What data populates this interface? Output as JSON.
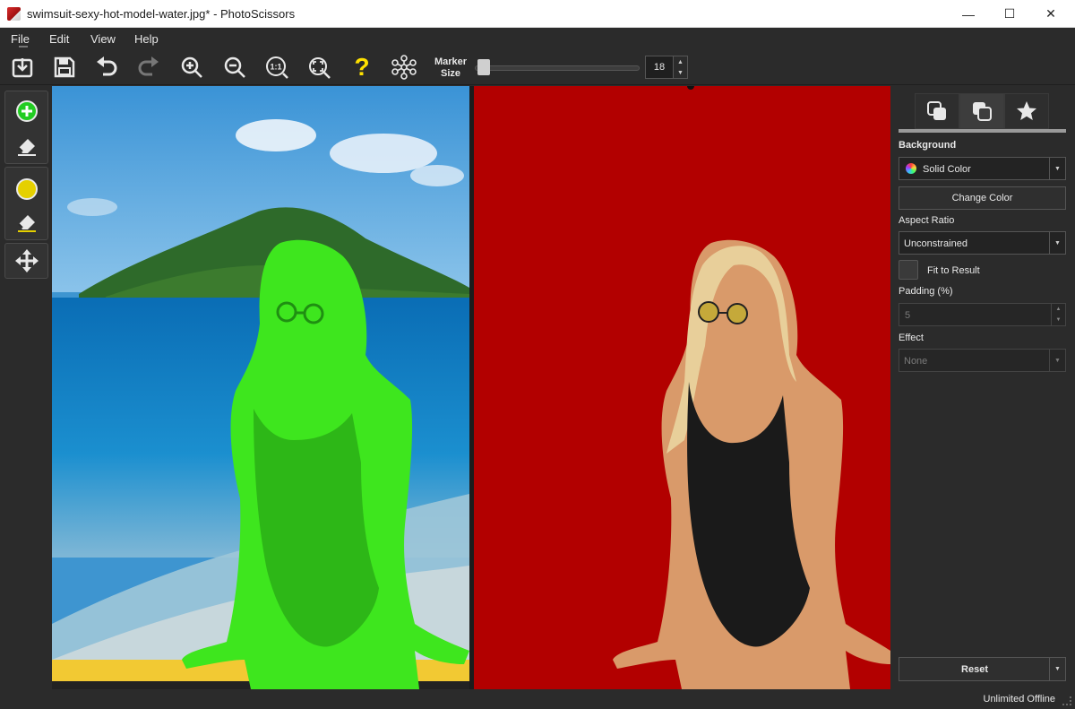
{
  "window": {
    "title": "swimsuit-sexy-hot-model-water.jpg* - PhotoScissors",
    "minimize_glyph": "—",
    "maximize_glyph": "☐",
    "close_glyph": "✕"
  },
  "menu": {
    "file": "File",
    "edit": "Edit",
    "view": "View",
    "help": "Help"
  },
  "toolbar": {
    "icons": [
      "open-icon",
      "save-icon",
      "undo-icon",
      "redo-icon",
      "zoom-in-icon",
      "zoom-out-icon",
      "actual-size-icon",
      "fit-icon",
      "help-icon",
      "network-icon"
    ],
    "help_glyph": "?",
    "actual_size_glyph": "1:1",
    "marker_label_line1": "Marker",
    "marker_label_line2": "Size",
    "marker_size_value": "18",
    "marker_size_fraction": 0.02,
    "spin_up": "▲",
    "spin_down": "▼"
  },
  "tools": {
    "icons": [
      "foreground-marker-icon",
      "foreground-eraser-icon",
      "background-marker-icon",
      "background-eraser-icon",
      "move-icon"
    ],
    "foreground_color": "#22cc22",
    "background_color": "#e5d000"
  },
  "canvas": {
    "overlay_color": "#3ee61e",
    "background_fill": "#b20000"
  },
  "panel": {
    "tab_icons": [
      "layers-front-icon",
      "layers-back-icon",
      "star-icon"
    ],
    "background_label": "Background",
    "background_value": "Solid Color",
    "change_color_label": "Change Color",
    "aspect_ratio_label": "Aspect Ratio",
    "aspect_ratio_value": "Unconstrained",
    "fit_to_result_label": "Fit to Result",
    "padding_label": "Padding (%)",
    "padding_value": "5",
    "effect_label": "Effect",
    "effect_value": "None",
    "reset_label": "Reset",
    "dropdown_glyph": "▼"
  },
  "status": {
    "license": "Unlimited Offline"
  }
}
